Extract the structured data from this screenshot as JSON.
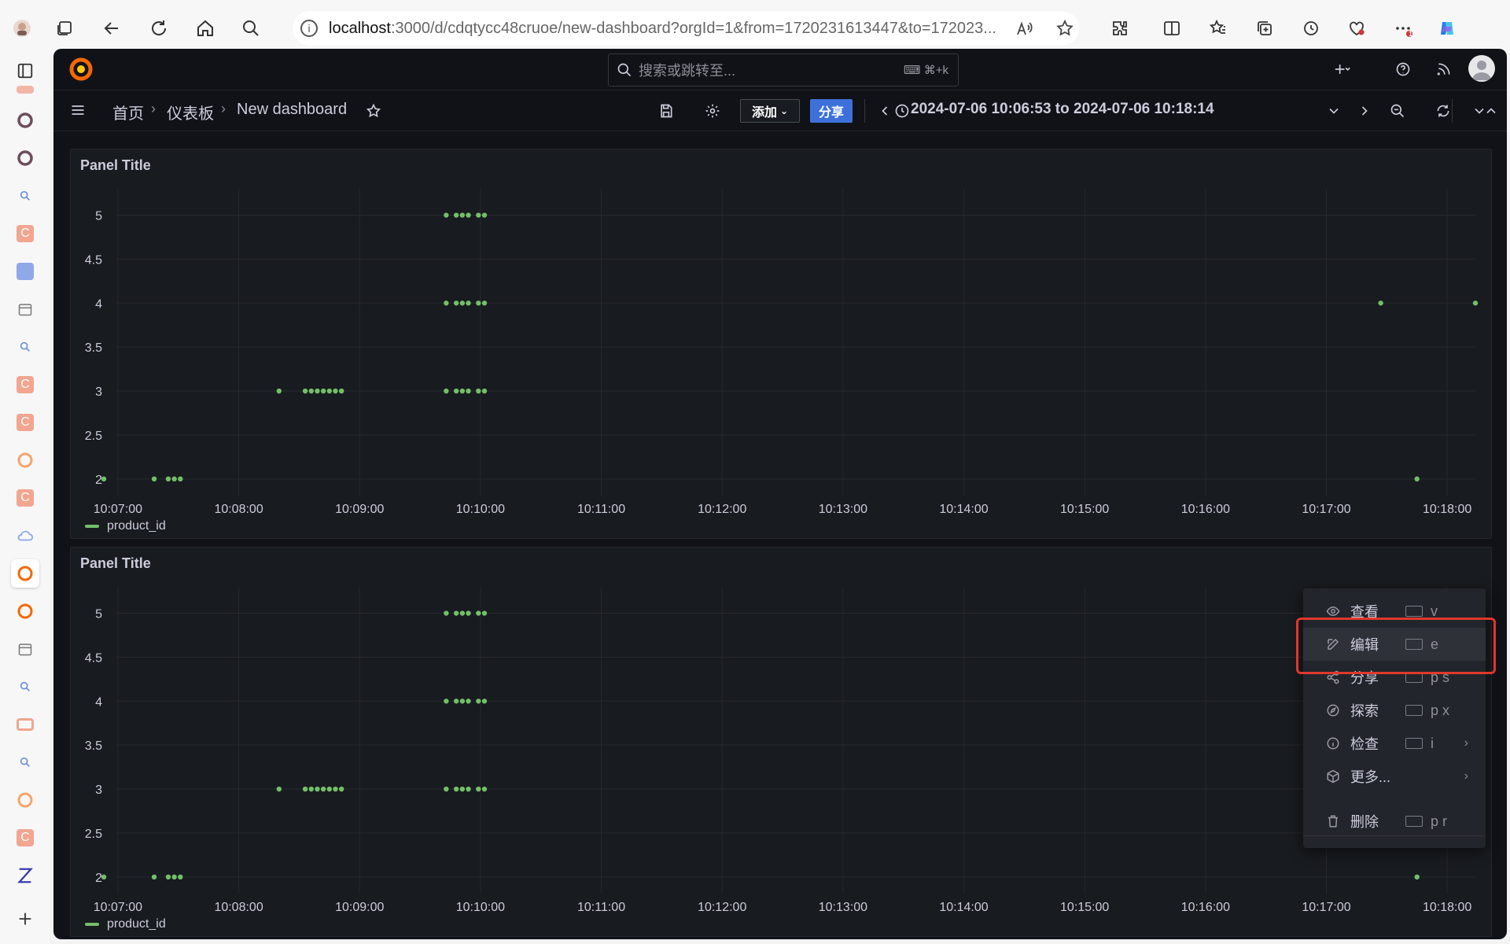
{
  "browser": {
    "url_host": "localhost",
    "url_rest": ":3000/d/cdqtycc48cruoe/new-dashboard?orgId=1&from=1720231613447&to=172023...",
    "notification_badge": "1"
  },
  "topnav": {
    "search_placeholder": "搜索或跳转至...",
    "search_shortcut": "⌘+k"
  },
  "toolbar": {
    "breadcrumbs": [
      "首页",
      "仪表板",
      "New dashboard"
    ],
    "add_label": "添加",
    "share_label": "分享",
    "time_range": "2024-07-06 10:06:53 to 2024-07-06 10:18:14"
  },
  "panels": [
    {
      "title": "Panel Title",
      "legend": "product_id"
    },
    {
      "title": "Panel Title",
      "legend": "product_id"
    }
  ],
  "chart_data": [
    {
      "type": "scatter",
      "title": "Panel Title",
      "series": [
        {
          "name": "product_id",
          "color": "#73bf69"
        }
      ],
      "ylim": [
        1.9,
        5.3
      ],
      "yticks": [
        2,
        2.5,
        3,
        3.5,
        4,
        4.5,
        5
      ],
      "xticks": [
        "10:07:00",
        "10:08:00",
        "10:09:00",
        "10:10:00",
        "10:11:00",
        "10:12:00",
        "10:13:00",
        "10:14:00",
        "10:15:00",
        "10:16:00",
        "10:17:00",
        "10:18:00"
      ],
      "points": [
        [
          "10:06:53",
          2
        ],
        [
          "10:07:18",
          2
        ],
        [
          "10:07:25",
          2
        ],
        [
          "10:07:28",
          2
        ],
        [
          "10:07:31",
          2
        ],
        [
          "10:08:20",
          3
        ],
        [
          "10:08:33",
          3
        ],
        [
          "10:08:36",
          3
        ],
        [
          "10:08:39",
          3
        ],
        [
          "10:08:42",
          3
        ],
        [
          "10:08:45",
          3
        ],
        [
          "10:08:48",
          3
        ],
        [
          "10:08:51",
          3
        ],
        [
          "10:09:43",
          3
        ],
        [
          "10:09:48",
          3
        ],
        [
          "10:09:51",
          3
        ],
        [
          "10:09:54",
          3
        ],
        [
          "10:09:59",
          3
        ],
        [
          "10:10:02",
          3
        ],
        [
          "10:09:43",
          4
        ],
        [
          "10:09:48",
          4
        ],
        [
          "10:09:51",
          4
        ],
        [
          "10:09:54",
          4
        ],
        [
          "10:09:59",
          4
        ],
        [
          "10:10:02",
          4
        ],
        [
          "10:09:43",
          5
        ],
        [
          "10:09:48",
          5
        ],
        [
          "10:09:51",
          5
        ],
        [
          "10:09:54",
          5
        ],
        [
          "10:09:59",
          5
        ],
        [
          "10:10:02",
          5
        ],
        [
          "10:17:27",
          4
        ],
        [
          "10:17:45",
          2
        ],
        [
          "10:18:14",
          4
        ]
      ],
      "grid": true,
      "legend_position": "bottom-left"
    }
  ],
  "context_menu": {
    "items": [
      {
        "label": "查看",
        "shortcut": "v",
        "icon": "eye-icon"
      },
      {
        "label": "编辑",
        "shortcut": "e",
        "icon": "edit-icon",
        "active": true
      },
      {
        "label": "分享",
        "shortcut": "p s",
        "icon": "share-icon"
      },
      {
        "label": "探索",
        "shortcut": "p x",
        "icon": "compass-icon"
      },
      {
        "label": "检查",
        "shortcut": "i",
        "icon": "info-icon",
        "submenu": true
      },
      {
        "label": "更多...",
        "shortcut": "",
        "icon": "cube-icon",
        "submenu": true
      },
      {
        "label": "删除",
        "shortcut": "p r",
        "icon": "trash-icon"
      }
    ]
  }
}
